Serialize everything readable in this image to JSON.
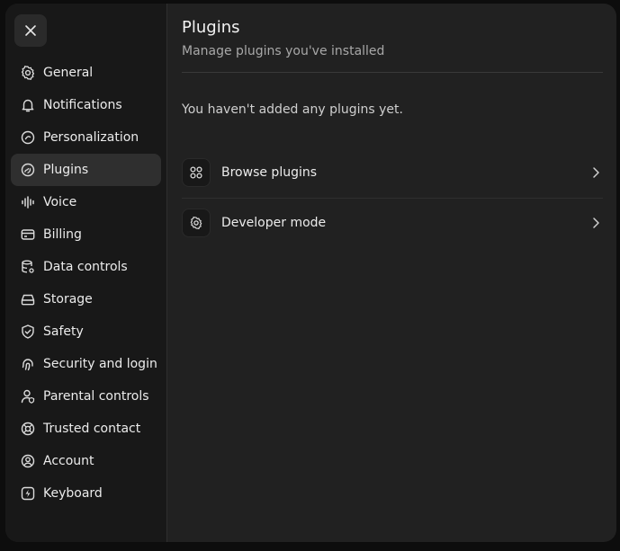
{
  "dialog": {
    "close_icon": "close-icon"
  },
  "sidebar": {
    "items": [
      {
        "label": "General",
        "icon": "gear-icon"
      },
      {
        "label": "Notifications",
        "icon": "bell-icon"
      },
      {
        "label": "Personalization",
        "icon": "personalization-icon"
      },
      {
        "label": "Plugins",
        "icon": "plugins-icon",
        "active": true
      },
      {
        "label": "Voice",
        "icon": "waveform-icon"
      },
      {
        "label": "Billing",
        "icon": "card-icon"
      },
      {
        "label": "Data controls",
        "icon": "database-gear-icon"
      },
      {
        "label": "Storage",
        "icon": "storage-icon"
      },
      {
        "label": "Safety",
        "icon": "shield-check-icon"
      },
      {
        "label": "Security and login",
        "icon": "fingerprint-icon"
      },
      {
        "label": "Parental controls",
        "icon": "user-shield-icon"
      },
      {
        "label": "Trusted contact",
        "icon": "lifebuoy-icon"
      },
      {
        "label": "Account",
        "icon": "user-circle-icon"
      },
      {
        "label": "Keyboard",
        "icon": "keyboard-bolt-icon"
      }
    ]
  },
  "main": {
    "title": "Plugins",
    "subtitle": "Manage plugins you've installed",
    "empty_text": "You haven't added any plugins yet.",
    "rows": [
      {
        "label": "Browse plugins",
        "icon": "grid-icon"
      },
      {
        "label": "Developer mode",
        "icon": "gear-icon"
      }
    ]
  }
}
